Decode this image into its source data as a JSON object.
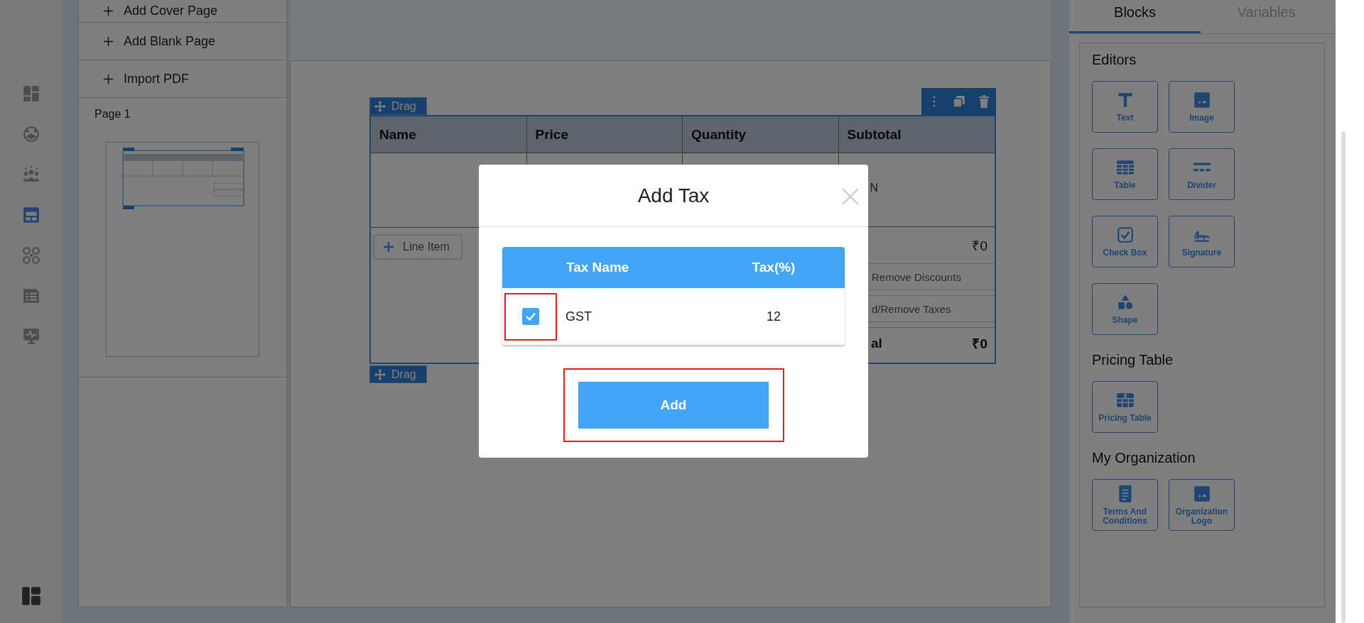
{
  "nav_rail": {
    "items": [
      {
        "selected": false
      },
      {
        "selected": false
      },
      {
        "selected": false
      },
      {
        "selected": true
      },
      {
        "selected": false
      },
      {
        "selected": false
      },
      {
        "selected": false
      }
    ]
  },
  "pages_panel": {
    "actions": [
      {
        "label": "Add Cover Page"
      },
      {
        "label": "Add Blank Page"
      },
      {
        "label": "Import PDF"
      }
    ],
    "pages": [
      {
        "label": "Page 1"
      }
    ]
  },
  "document": {
    "drag_top": "Drag",
    "columns": [
      "Name",
      "Price",
      "Quantity",
      "Subtotal"
    ],
    "row_cell": "N",
    "line_item": "Line Item",
    "summary": [
      {
        "kind": "amount",
        "value": "₹0"
      },
      {
        "kind": "action",
        "label": "Remove Discounts"
      },
      {
        "kind": "action",
        "label": "d/Remove Taxes"
      },
      {
        "kind": "total",
        "label": "al",
        "value": "₹0"
      }
    ],
    "drag_bottom": "Drag"
  },
  "modal": {
    "title": "Add Tax",
    "columns": [
      "Tax Name",
      "Tax(%)"
    ],
    "rows": [
      {
        "checked": true,
        "highlighted": true,
        "name": "GST",
        "tax": "12"
      }
    ],
    "button": "Add",
    "button_highlighted": true
  },
  "right_panel": {
    "tabs": [
      {
        "label": "Blocks",
        "selected": true
      },
      {
        "label": "Variables",
        "selected": false
      }
    ],
    "sections": [
      {
        "title": "Editors",
        "blocks": [
          {
            "kind": "text",
            "label": "Text"
          },
          {
            "kind": "image",
            "label": "Image"
          },
          {
            "kind": "table",
            "label": "Table"
          },
          {
            "kind": "divider",
            "label": "Divider"
          },
          {
            "kind": "checkbox",
            "label": "Check Box"
          },
          {
            "kind": "signature",
            "label": "Signature"
          },
          {
            "kind": "shape",
            "label": "Shape"
          }
        ]
      },
      {
        "title": "Pricing Table",
        "blocks": [
          {
            "kind": "pricing",
            "label": "Pricing Table"
          }
        ]
      },
      {
        "title": "My Organization",
        "blocks": [
          {
            "kind": "terms",
            "label": "Terms And Conditions"
          },
          {
            "kind": "image",
            "label": "Organization Logo"
          }
        ]
      }
    ]
  }
}
